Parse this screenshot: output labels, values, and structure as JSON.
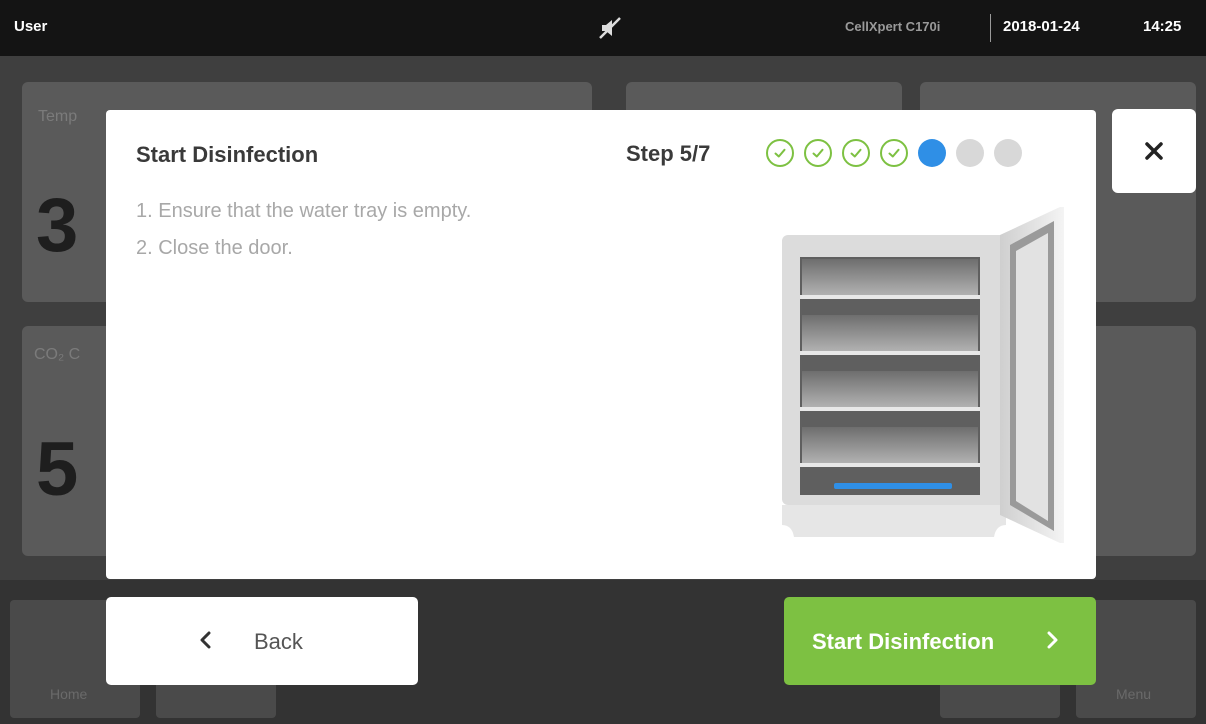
{
  "statusbar": {
    "user": "User",
    "mute_icon": "muted-speaker-icon",
    "device_model": "CellXpert C170i",
    "date": "2018-01-24",
    "time": "14:25"
  },
  "background": {
    "temp_label": "Temp",
    "temp_value_partial": "3",
    "co2_label": "CO₂ C",
    "co2_value_partial": "5",
    "home_label": "Home",
    "menu_label": "Menu"
  },
  "dialog": {
    "title": "Start Disinfection",
    "step_label": "Step 5/7",
    "current_step": 5,
    "total_steps": 7,
    "steps": [
      {
        "state": "done"
      },
      {
        "state": "done"
      },
      {
        "state": "done"
      },
      {
        "state": "done"
      },
      {
        "state": "current"
      },
      {
        "state": "todo"
      },
      {
        "state": "todo"
      }
    ],
    "instructions": [
      "1. Ensure that the water tray is empty.",
      "2. Close the door."
    ],
    "illustration": "incubator-open-door-with-water-tray"
  },
  "buttons": {
    "close_icon": "close-icon",
    "back_label": "Back",
    "start_label": "Start Disinfection"
  },
  "colors": {
    "accent_green": "#7dc142",
    "current_blue": "#2f8fe6",
    "pending_gray": "#d8d8d8"
  }
}
